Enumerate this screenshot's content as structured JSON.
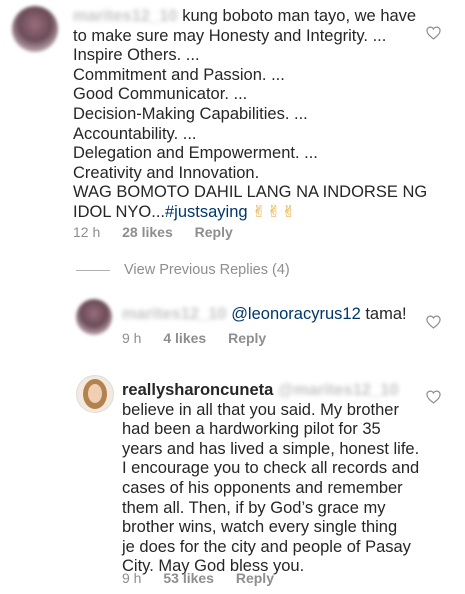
{
  "comment1": {
    "username_blurred": "marites12_10",
    "lines": [
      "kung boboto man tayo, we have",
      "to make sure may Honesty and Integrity. ...",
      "Inspire Others. ...",
      "Commitment and Passion. ...",
      "Good Communicator. ...",
      "Decision-Making Capabilities. ...",
      "Accountability. ...",
      "Delegation and Empowerment. ...",
      "Creativity and Innovation.",
      "WAG BOMOTO DAHIL LANG NA INDORSE NG"
    ],
    "last_line_prefix": "IDOL NYO...",
    "hashtag": "#justsaying",
    "emojis": "✌✌✌",
    "time": "12 h",
    "likes": "28 likes",
    "reply": "Reply"
  },
  "view_previous_replies": "View Previous Replies (4)",
  "reply1": {
    "username_blurred": "marites12_10",
    "mention": "@leonoracyrus12",
    "text": " tama!",
    "time": "9 h",
    "likes": "4 likes",
    "reply": "Reply"
  },
  "reply2": {
    "username": "reallysharoncuneta",
    "mention_blurred": "@marites12_10",
    "lines": [
      "believe in all that you said. My brother",
      "had been a hardworking pilot for 35",
      "years and has lived a simple, honest life.",
      "I encourage you to check all records and",
      "cases of his opponents and remember",
      "them all. Then, if by God’s grace my",
      "brother wins, watch every single thing",
      "je does for the city and people of Pasay",
      "City. May God bless you."
    ],
    "time": "9 h",
    "likes": "53 likes",
    "reply": "Reply"
  },
  "icons": {
    "heart": "heart-outline-icon"
  },
  "colors": {
    "text": "#262626",
    "meta": "#8e8e8e",
    "link": "#00376b"
  }
}
